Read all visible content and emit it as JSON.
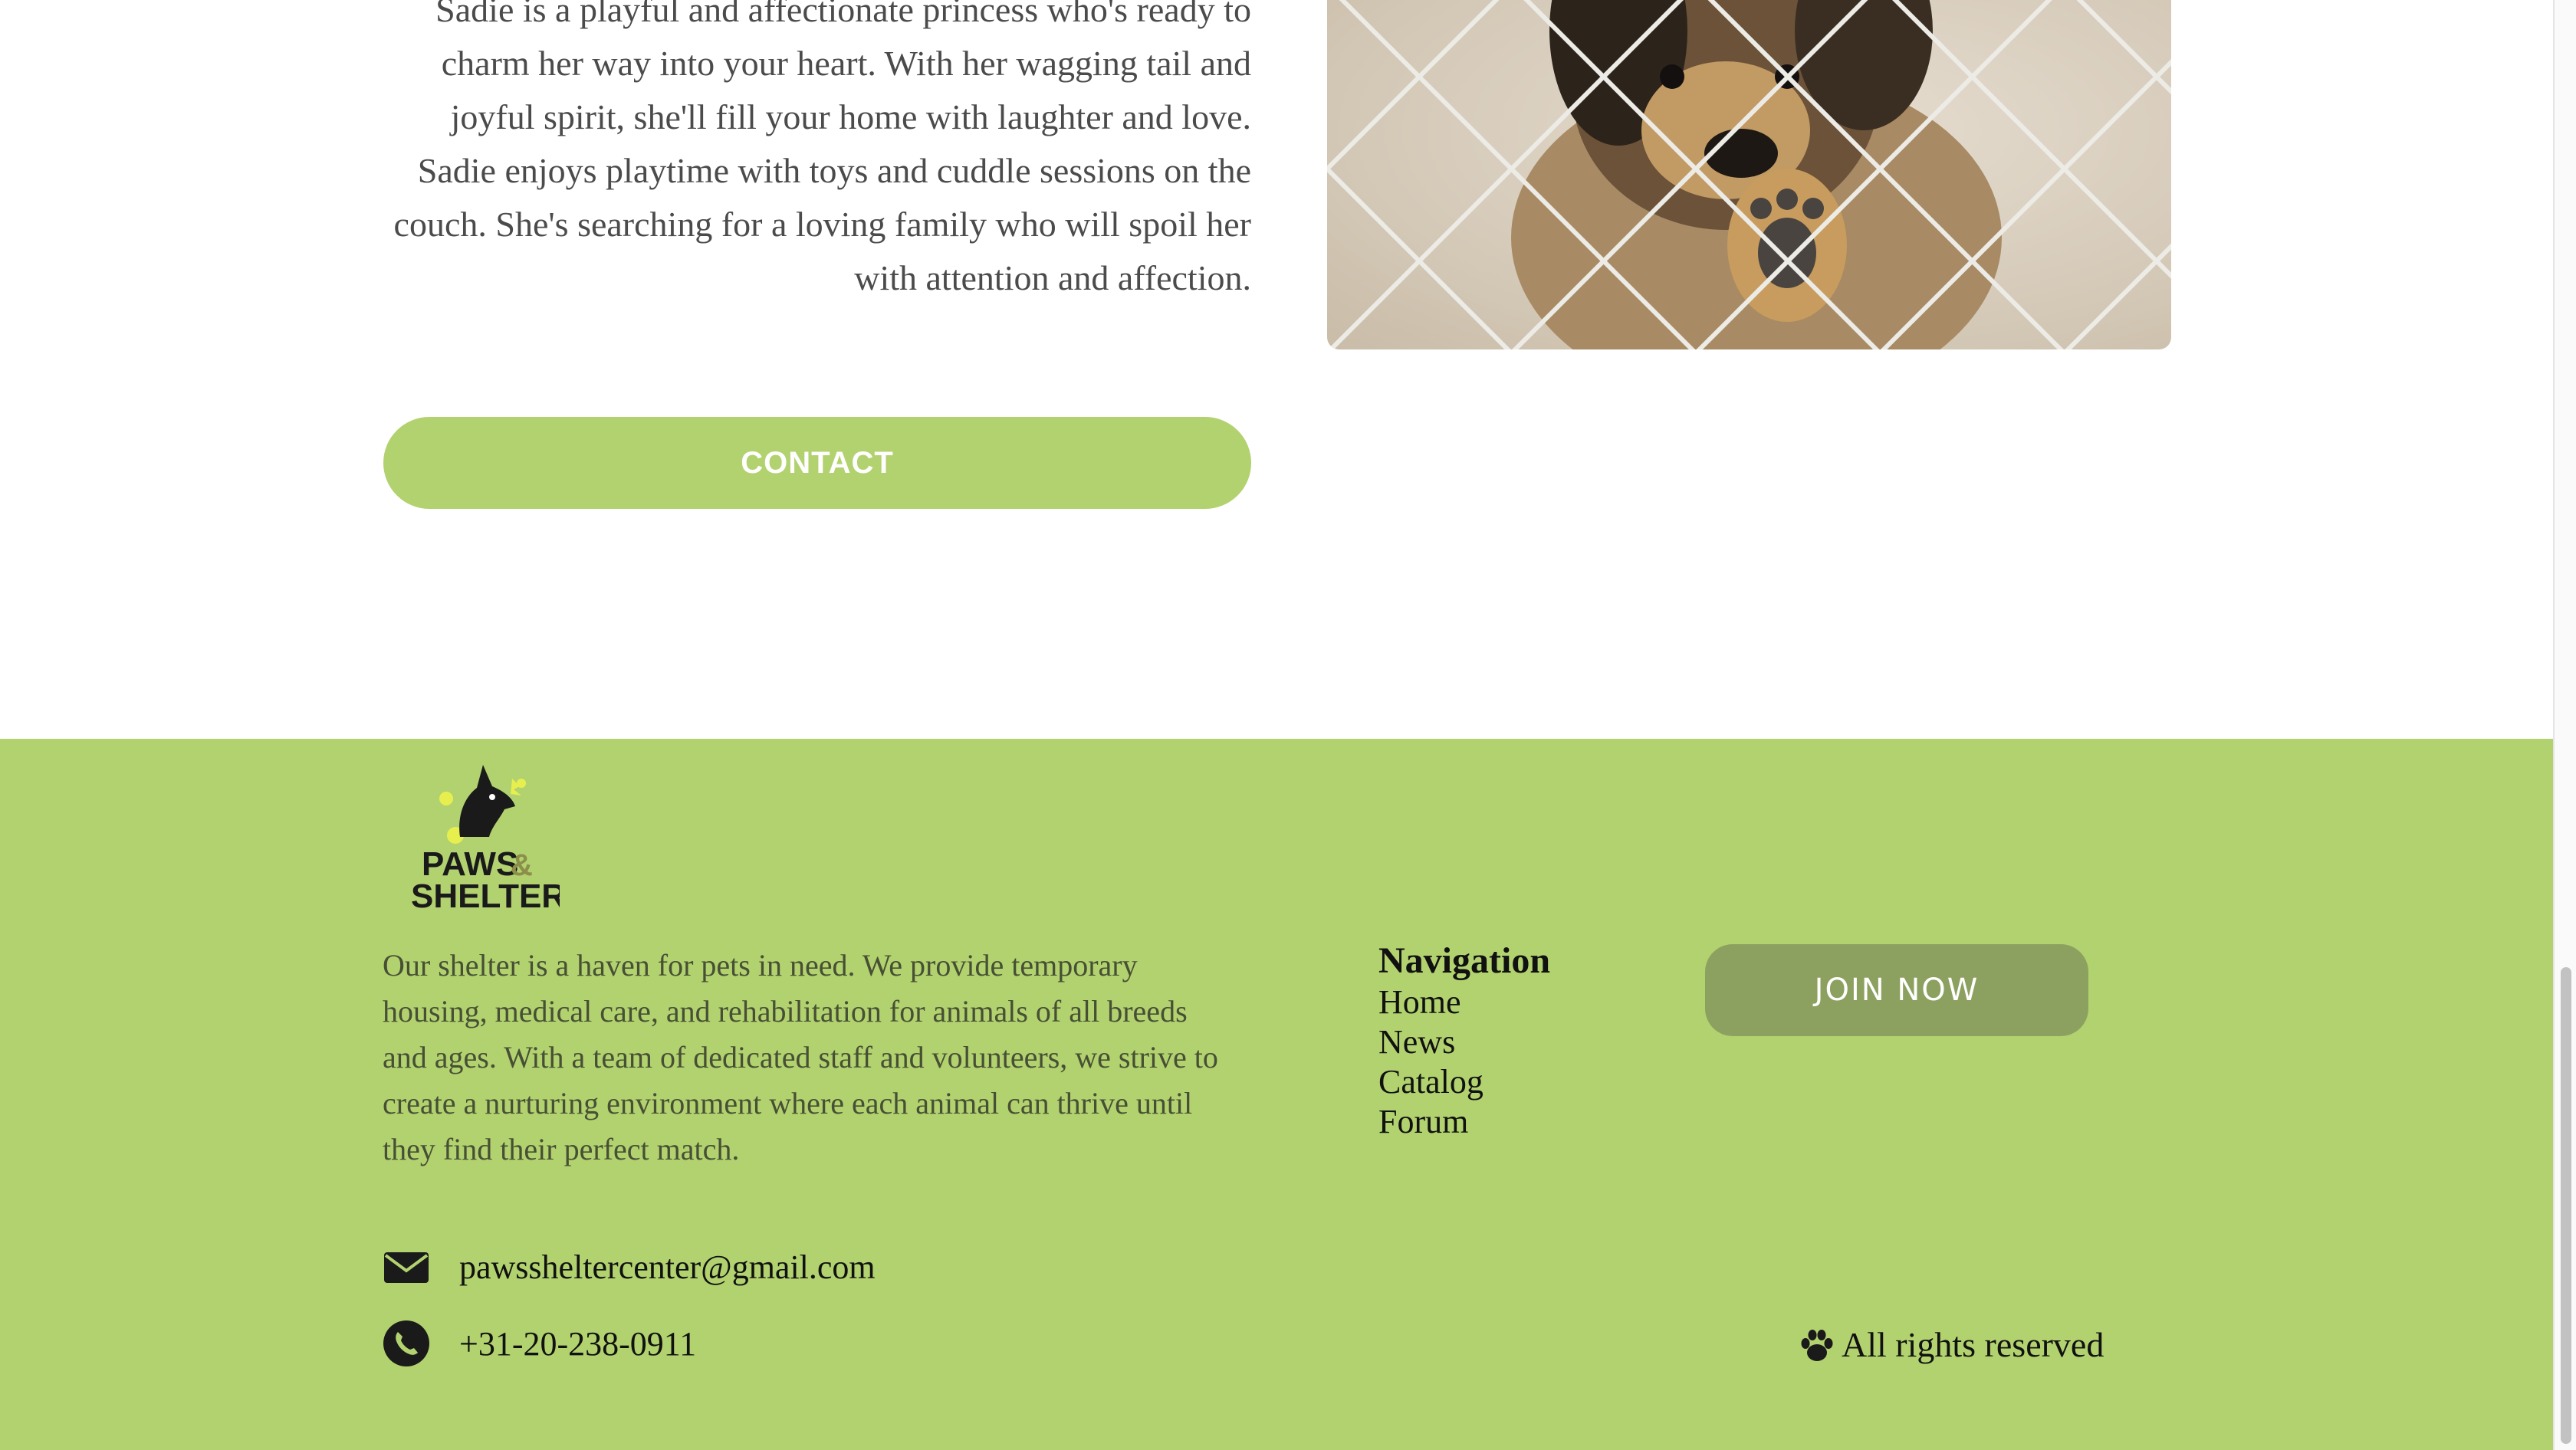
{
  "pet_profile": {
    "bio": "Sadie is a playful and affectionate princess who's ready to charm her way into your heart. With her wagging tail and joyful spirit, she'll fill your home with laughter and love. Sadie enjoys playtime with toys and cuddle sessions on the couch. She's searching for a loving family who will spoil her with attention and affection.",
    "photo_icon": "puppy-behind-fence-photo",
    "contact_label": "CONTACT"
  },
  "footer": {
    "logo": {
      "line1": "PAWS",
      "ampersand": "&",
      "line2": "SHELTER"
    },
    "about": "Our shelter is a haven for pets in need. We provide temporary housing, medical care, and rehabilitation for animals of all breeds and ages. With a team of dedicated staff and volunteers, we strive to create a nurturing environment where each animal can thrive until they find their perfect match.",
    "navigation": {
      "heading": "Navigation",
      "items": [
        {
          "label": "Home"
        },
        {
          "label": "News"
        },
        {
          "label": "Catalog"
        },
        {
          "label": "Forum"
        }
      ]
    },
    "join_label": "JOIN NOW",
    "email": {
      "icon": "envelope-icon",
      "value": "pawssheltercenter@gmail.com"
    },
    "phone": {
      "icon": "phone-icon",
      "value": "+31-20-238-0911"
    },
    "rights": {
      "icon": "paw-icon",
      "text": "All rights reserved"
    }
  },
  "colors": {
    "accent_green": "#b2d26f",
    "join_button": "#8ca15f",
    "text_dark": "#111111",
    "body_text": "#4b4b4b"
  }
}
